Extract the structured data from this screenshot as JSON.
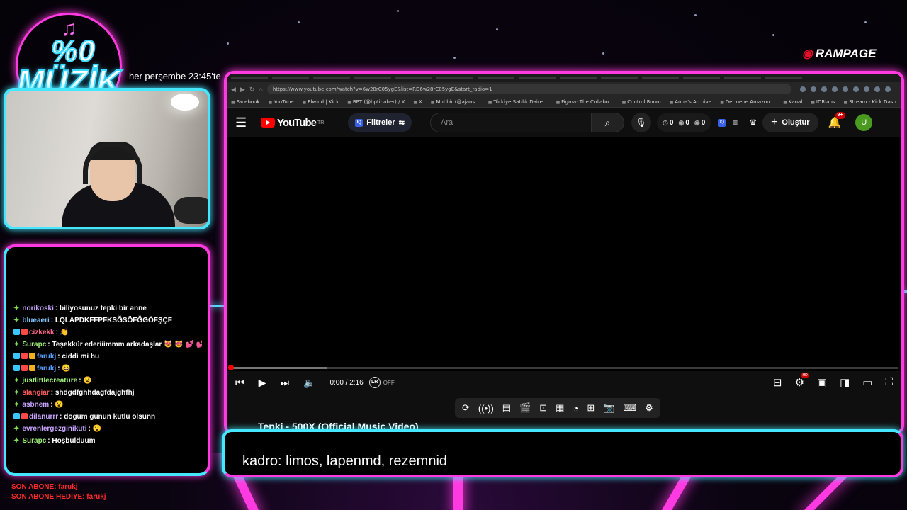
{
  "overlay": {
    "logo_top": "%0",
    "logo_main": "MÜZİK",
    "schedule": "her perşembe 23:45'te",
    "sponsor": "RAMPAGE",
    "caption": "kadro: limos, lapenmd, rezemnid",
    "last_sub": "SON ABONE: farukj",
    "last_gift": "SON ABONE HEDİYE: farukj",
    "neon_colors": {
      "pink": "#ff3ae0",
      "cyan": "#45e6ff"
    }
  },
  "chat": [
    {
      "user": "norikoski",
      "text": ": biliyosunuz tepki bir anne",
      "color": "#c9a6ff",
      "badges": []
    },
    {
      "user": "blueaeri",
      "text": ": LQLAPDKFFPFKSĞSÖFĞGÖFŞÇF",
      "color": "#7fc8ff",
      "badges": []
    },
    {
      "user": "cizkekk",
      "text": ": 👏",
      "color": "#ff6a8a",
      "badges": [
        "#38c8ff",
        "#ff4a4a"
      ]
    },
    {
      "user": "Surapc",
      "text": ": Teşekkür ederiiimmm arkadaşlar 😻 😻 💕 💕",
      "color": "#9ef07a",
      "badges": []
    },
    {
      "user": "farukj",
      "text": ": ciddi mi bu",
      "color": "#5aa0ff",
      "badges": [
        "#38c8ff",
        "#ff4a4a",
        "#f0b020"
      ]
    },
    {
      "user": "farukj",
      "text": ": 😄",
      "color": "#5aa0ff",
      "badges": [
        "#38c8ff",
        "#ff4a4a",
        "#f0b020"
      ]
    },
    {
      "user": "justlittlecreature",
      "text": ": 😮",
      "color": "#9ef07a",
      "badges": []
    },
    {
      "user": "slangiar",
      "text": ": shdgdfghhdagfdajghfhj",
      "color": "#ff5a5a",
      "badges": []
    },
    {
      "user": "asbnem",
      "text": ": 😮",
      "color": "#c9a6ff",
      "badges": []
    },
    {
      "user": "dilanurrr",
      "text": ": dogum gunun kutlu olsunn",
      "color": "#c9a6ff",
      "badges": [
        "#38c8ff",
        "#ff4a4a"
      ]
    },
    {
      "user": "evrenlergezginikuti",
      "text": ": 😮",
      "color": "#c9a6ff",
      "badges": []
    },
    {
      "user": "Surapc",
      "text": ": Hoşbulduum",
      "color": "#9ef07a",
      "badges": []
    }
  ],
  "browser": {
    "url": "https://www.youtube.com/watch?v=6w28rC05ygE&list=RD6w28rC05ygE&start_radio=1",
    "bookmarks": [
      "Facebook",
      "YouTube",
      "Elwind | Kick",
      "BPT (@bptihaber) / X",
      "X",
      "Muhbir (@ajans...",
      "Türkiye Satılık Daire...",
      "Figma: The Collabo...",
      "Control Room",
      "Anna's Archive",
      "Der neue Amazon...",
      "Kanal",
      "IDRlabs",
      "Stream - Kick Dash..."
    ]
  },
  "youtube": {
    "logo": "YouTube",
    "region": "TR",
    "filters": "Filtreler",
    "search_placeholder": "Ara",
    "stat1": "0",
    "stat2": "0",
    "stat3": "0",
    "create": "Oluştur",
    "notifications": "9+",
    "avatar": "U",
    "time": "0:00 / 2:16",
    "lr_label": "LR",
    "lr_state": "OFF",
    "progress_buffered": 0.145,
    "video_title": "Tepki - 500X (Official Music Video)",
    "hd_badge": "HD"
  }
}
